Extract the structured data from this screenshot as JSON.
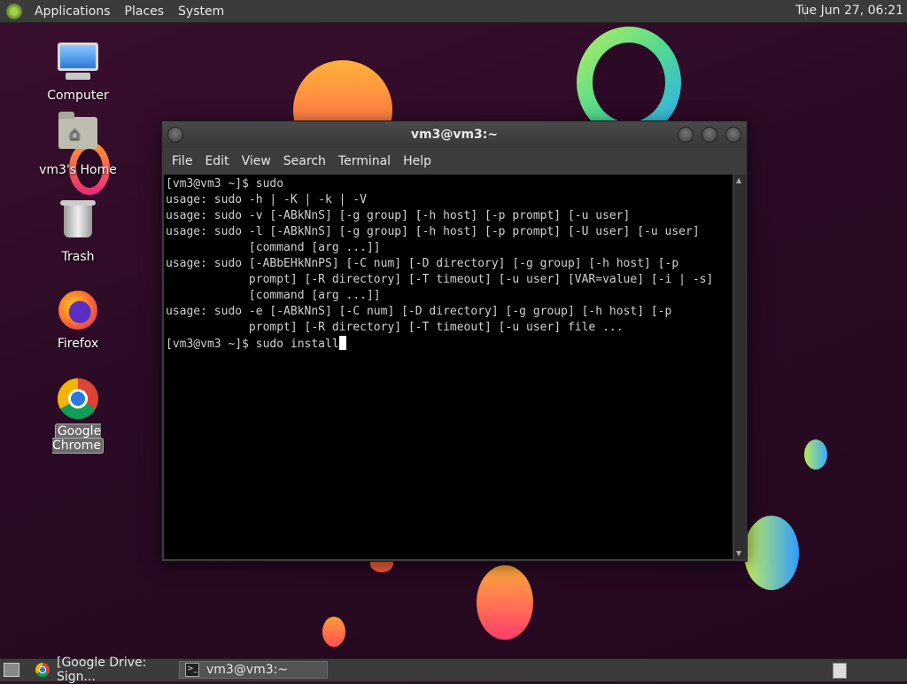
{
  "top_panel": {
    "menus": [
      "Applications",
      "Places",
      "System"
    ],
    "clock": "Tue Jun 27, 06:21"
  },
  "desktop_icons": [
    {
      "label": "Computer",
      "icon": "computer-icon"
    },
    {
      "label": "vm3's Home",
      "icon": "home-folder-icon"
    },
    {
      "label": "Trash",
      "icon": "trash-icon"
    },
    {
      "label": "Firefox",
      "icon": "firefox-icon"
    },
    {
      "label": "Google Chrome",
      "icon": "chrome-icon",
      "selected": true
    }
  ],
  "terminal": {
    "title": "vm3@vm3:~",
    "menus": [
      "File",
      "Edit",
      "View",
      "Search",
      "Terminal",
      "Help"
    ],
    "lines": [
      "[vm3@vm3 ~]$ sudo",
      "usage: sudo -h | -K | -k | -V",
      "usage: sudo -v [-ABkNnS] [-g group] [-h host] [-p prompt] [-u user]",
      "usage: sudo -l [-ABkNnS] [-g group] [-h host] [-p prompt] [-U user] [-u user]",
      "            [command [arg ...]]",
      "usage: sudo [-ABbEHkNnPS] [-C num] [-D directory] [-g group] [-h host] [-p",
      "            prompt] [-R directory] [-T timeout] [-u user] [VAR=value] [-i | -s]",
      "            [command [arg ...]]",
      "usage: sudo -e [-ABkNnS] [-C num] [-D directory] [-g group] [-h host] [-p",
      "            prompt] [-R directory] [-T timeout] [-u user] file ...",
      "[vm3@vm3 ~]$ sudo install"
    ]
  },
  "taskbar": {
    "tasks": [
      {
        "label": "[Google Drive: Sign...",
        "icon": "chrome-icon",
        "active": false
      },
      {
        "label": "vm3@vm3:~",
        "icon": "terminal-icon",
        "active": true
      }
    ]
  }
}
